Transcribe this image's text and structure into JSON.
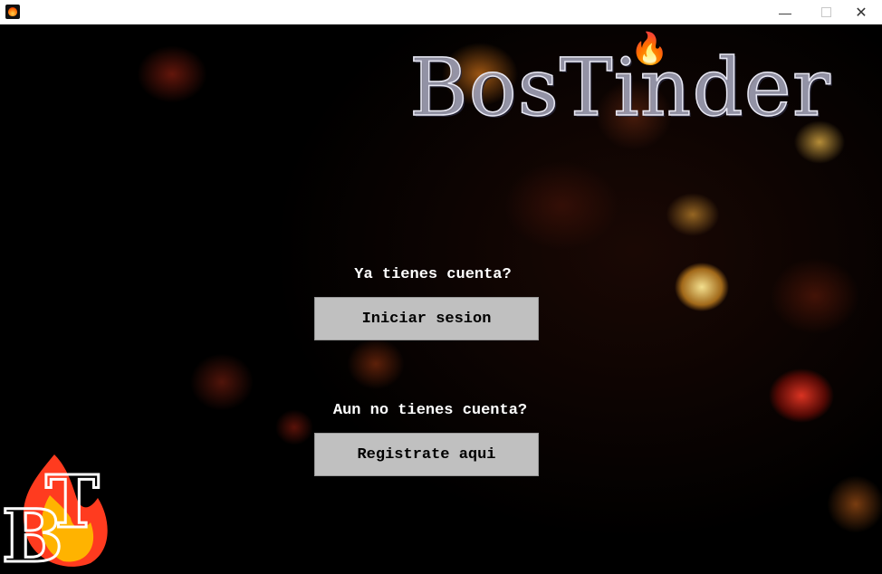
{
  "titlebar": {
    "app_icon": "bostinder-flame-icon",
    "minimize_glyph": "—",
    "close_glyph": "✕"
  },
  "logo": {
    "brand_name": "BosTinder",
    "flame_icon": "🔥",
    "monogram": "BT"
  },
  "login": {
    "prompt": "Ya tienes cuenta?",
    "button_label": "Iniciar sesion"
  },
  "register": {
    "prompt": "Aun no tienes cuenta?",
    "button_label": "Registrate aqui"
  },
  "colors": {
    "button_bg": "#c0c0c0",
    "text_white": "#ffffff",
    "background": "#000000"
  }
}
